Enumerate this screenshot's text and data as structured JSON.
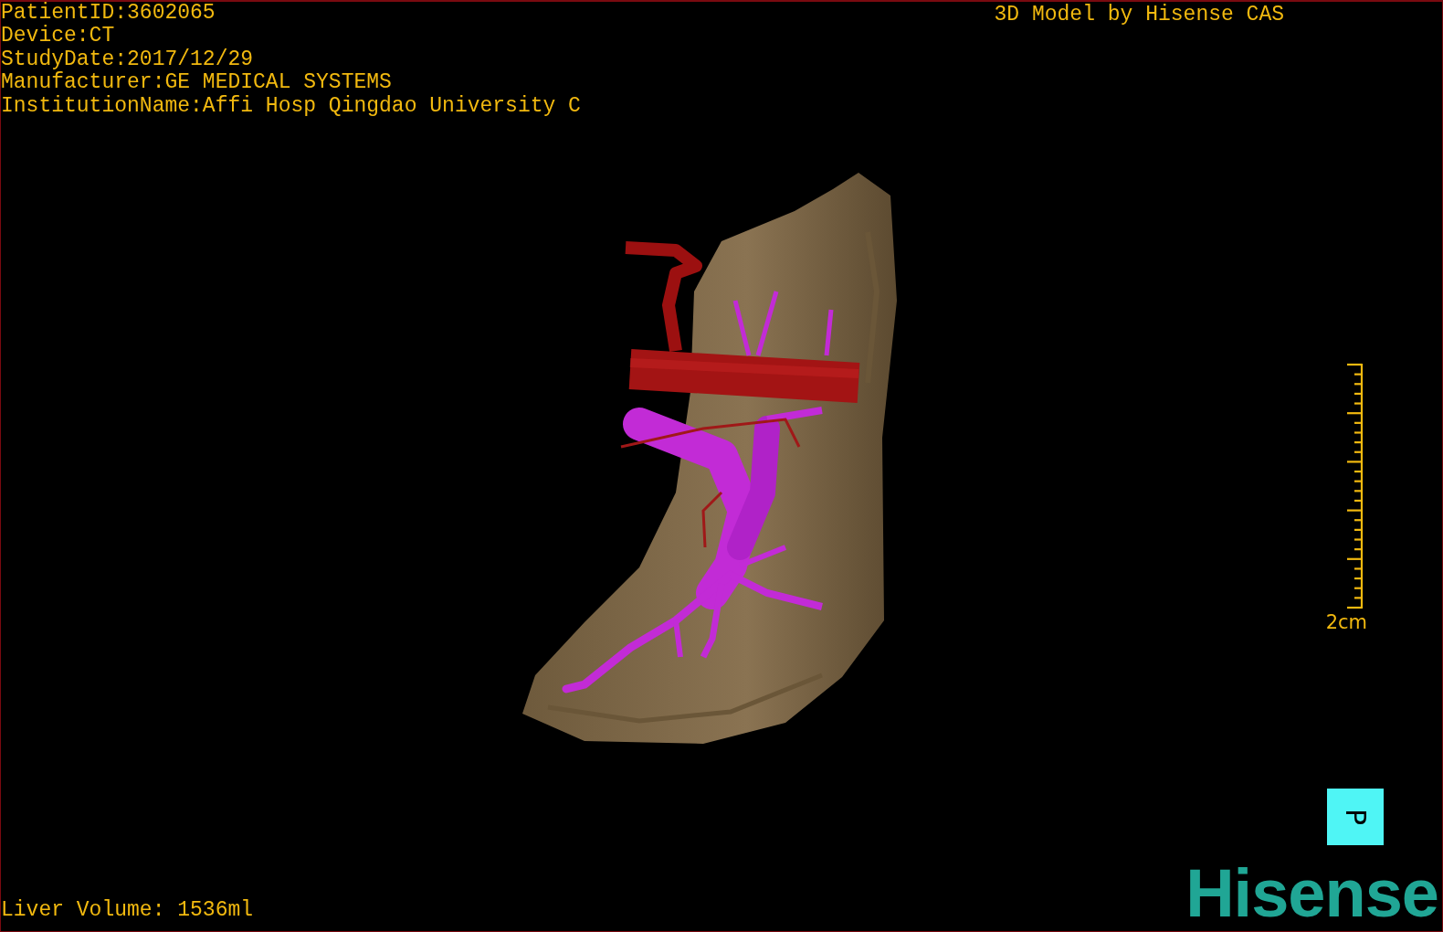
{
  "patient_info": [
    "PatientID:3602065",
    "Device:CT",
    "StudyDate:2017/12/29",
    "Manufacturer:GE MEDICAL SYSTEMS",
    "InstitutionName:Affi Hosp Qingdao University C"
  ],
  "title": "3D Model by Hisense CAS",
  "scale_bar": {
    "label": "2cm"
  },
  "orientation_cube": {
    "label": "P"
  },
  "liver_volume": "Liver Volume: 1536ml",
  "logo": "Hisense"
}
